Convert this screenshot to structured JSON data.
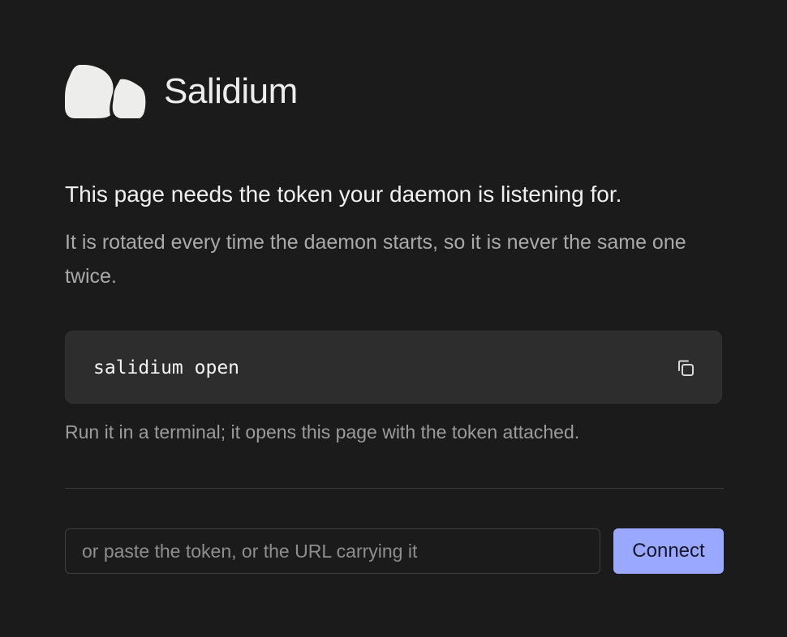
{
  "brand": {
    "name": "Salidium",
    "logo_icon": "pebbles-logo-icon",
    "logo_color": "#ededeb"
  },
  "main": {
    "headline": "This page needs the token your daemon is listening for.",
    "subtext": "It is rotated every time the daemon starts, so it is never the same one twice.",
    "command": {
      "text": "salidium open",
      "copy_icon": "copy-icon"
    },
    "hint": "Run it in a terminal; it opens this page with the token attached."
  },
  "token_form": {
    "placeholder": "or paste the token, or the URL carrying it",
    "value": "",
    "connect_label": "Connect",
    "accent_color": "#9aa8ff"
  }
}
